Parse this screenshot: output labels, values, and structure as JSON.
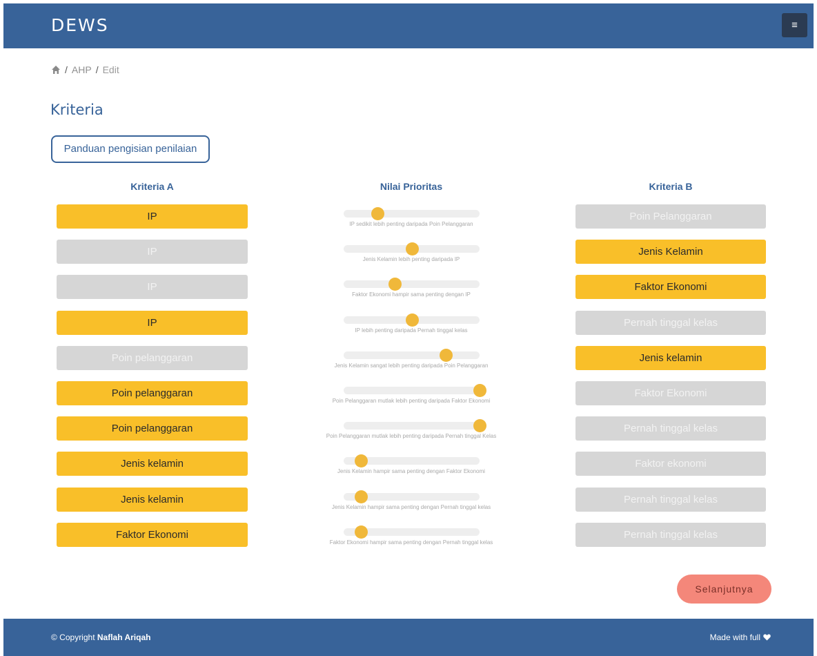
{
  "header": {
    "brand": "DEWS",
    "menu_icon": "≡"
  },
  "breadcrumb": {
    "home_icon": "home-icon",
    "items": [
      "AHP",
      "Edit"
    ]
  },
  "page_title": "Kriteria",
  "guide_button": "Panduan pengisian penilaian",
  "columns": {
    "a": "Kriteria A",
    "mid": "Nilai Prioritas",
    "b": "Kriteria B"
  },
  "colors": {
    "primary": "#386399",
    "selected": "#f9bf29",
    "unselected": "#d6d6d6",
    "slider_thumb": "#f0b83a",
    "next_button": "#f4877a"
  },
  "comparisons": [
    {
      "a": "IP",
      "b": "Poin Pelanggaran",
      "selected": "a",
      "slider_fraction": 0.25,
      "label": "IP sedikit lebih penting daripada Poin Pelanggaran"
    },
    {
      "a": "IP",
      "b": "Jenis Kelamin",
      "selected": "b",
      "slider_fraction": 0.5,
      "label": "Jenis Kelamin lebih penting daripada IP"
    },
    {
      "a": "IP",
      "b": "Faktor Ekonomi",
      "selected": "b",
      "slider_fraction": 0.375,
      "label": "Faktor Ekonomi hampir sama penting dengan IP"
    },
    {
      "a": "IP",
      "b": "Pernah tinggal kelas",
      "selected": "a",
      "slider_fraction": 0.5,
      "label": "IP lebih penting daripada Pernah tinggal kelas"
    },
    {
      "a": "Poin pelanggaran",
      "b": "Jenis kelamin",
      "selected": "b",
      "slider_fraction": 0.75,
      "label": "Jenis Kelamin sangat lebih penting daripada Poin Pelanggaran"
    },
    {
      "a": "Poin pelanggaran",
      "b": "Faktor Ekonomi",
      "selected": "a",
      "slider_fraction": 1.0,
      "label": "Poin Pelanggaran mutlak lebih penting daripada Faktor Ekonomi"
    },
    {
      "a": "Poin pelanggaran",
      "b": "Pernah tinggal kelas",
      "selected": "a",
      "slider_fraction": 1.0,
      "label": "Poin Pelanggaran mutlak lebih penting daripada Pernah tinggal Kelas"
    },
    {
      "a": "Jenis kelamin",
      "b": "Faktor ekonomi",
      "selected": "a",
      "slider_fraction": 0.125,
      "label": "Jenis Kelamin hampir sama penting dengan Faktor Ekonomi"
    },
    {
      "a": "Jenis kelamin",
      "b": "Pernah tinggal kelas",
      "selected": "a",
      "slider_fraction": 0.125,
      "label": "Jenis Kelamin hampir sama penting dengan Pernah tinggal kelas"
    },
    {
      "a": "Faktor Ekonomi",
      "b": "Pernah tinggal kelas",
      "selected": "a",
      "slider_fraction": 0.125,
      "label": "Faktor Ekonomi hampir sama penting dengan Pernah tinggal kelas"
    }
  ],
  "next_button": "Selanjutnya",
  "footer": {
    "copyright_prefix": "© Copyright ",
    "author": "Naflah Ariqah",
    "made_with": "Made with full",
    "heart_icon": "heart-icon"
  }
}
